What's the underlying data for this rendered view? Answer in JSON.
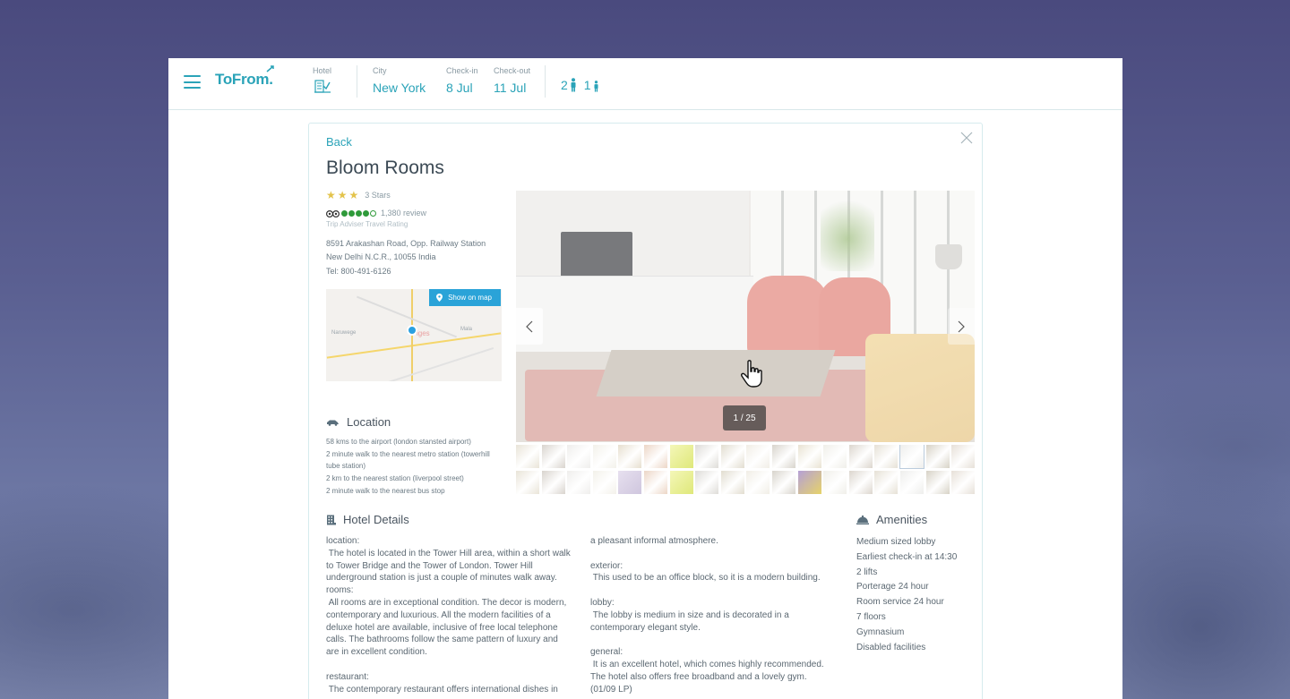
{
  "header": {
    "logo": "ToFrom.",
    "hotel_label": "Hotel",
    "city_label": "City",
    "city_value": "New York",
    "checkin_label": "Check-in",
    "checkin_value": "8 Jul",
    "checkout_label": "Check-out",
    "checkout_value": "11 Jul",
    "adults": "2",
    "children": "1"
  },
  "panel": {
    "back_label": "Back",
    "title": "Bloom Rooms",
    "stars_count": 3,
    "stars_label": "3 Stars",
    "tripadvisor_rating": 4.5,
    "review_count": "1,380 review",
    "ta_caption": "Trip Adviser Travel Rating",
    "address": "8591 Arakashan Road, Opp. Railway Station New Delhi N.C.R., 10055 India",
    "tel": "Tel: 800-491-6126",
    "map_button": "Show on map",
    "map_labels": [
      "Naruwege",
      "Mala",
      "iges"
    ],
    "location_title": "Location",
    "location_items": [
      "58 kms to the airport (london stansted airport)",
      "2 minute walk to the nearest metro station (towerhill tube station)",
      "2 km to the nearest station (liverpool street)",
      "2 minute walk to the nearest bus stop"
    ]
  },
  "gallery": {
    "counter": "1 / 25",
    "current": 1,
    "total": 25,
    "thumbnail_count": 36,
    "prev_icon": "chevron-left-icon",
    "next_icon": "chevron-right-icon"
  },
  "hotel_details": {
    "title": "Hotel Details",
    "col1": "location:\n The hotel is located in the Tower Hill area, within a short walk to Tower Bridge and the Tower of London. Tower Hill underground station is just a couple of minutes walk away.\nrooms:\n All rooms are in exceptional condition. The decor is modern, contemporary and luxurious. All the modern facilities of a deluxe hotel are available, inclusive of free local telephone calls. The bathrooms follow the same pattern of luxury and are in excellent condition.\n\nrestaurant:\n The contemporary restaurant offers international dishes in",
    "col2": "a pleasant informal atmosphere.\n\nexterior:\n This used to be an office block, so it is a modern building.\n\nlobby:\n The lobby is medium in size and is decorated in a contemporary elegant style.\n\ngeneral:\n It is an excellent hotel, which comes highly recommended. The hotel also offers free broadband and a lovely gym. (01/09 LP)"
  },
  "amenities": {
    "title": "Amenities",
    "items": [
      "Medium sized lobby",
      "Earliest check-in at 14:30",
      "2 lifts",
      "Porterage 24 hour",
      "Room service 24 hour",
      "7 floors",
      "Gymnasium",
      "Disabled facilities"
    ]
  },
  "colors": {
    "accent": "#2aa3b8",
    "star": "#e3c34b",
    "tripadvisor": "#2f9a3a",
    "map_button": "#2aa3d8"
  }
}
